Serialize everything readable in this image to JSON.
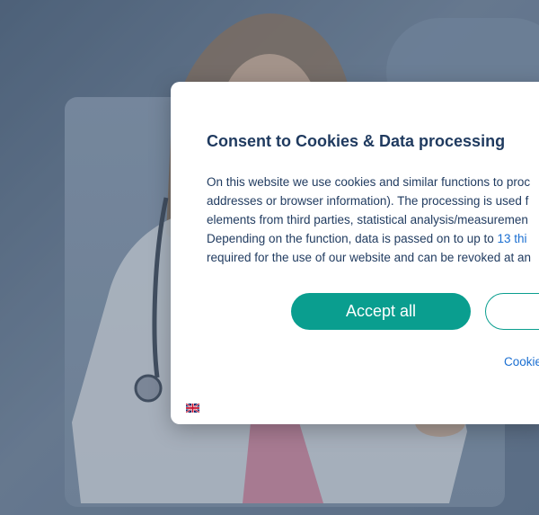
{
  "consent": {
    "title": "Consent to Cookies & Data processing",
    "body_line1": "On this website we use cookies and similar functions to proc",
    "body_line2": "addresses or browser information). The processing is used f",
    "body_line3": "elements from third parties, statistical analysis/measuremen",
    "body_line4_prefix": "Depending on the function, data is passed on to up to ",
    "body_line4_link": "13 thi",
    "body_line5": "required for the use of our website and can be revoked at an",
    "accept_label": "Accept all",
    "second_label": "",
    "cookie_link_label": "Cookie"
  },
  "language": {
    "flag_icon": "uk-flag-icon"
  },
  "colors": {
    "accent": "#0a9e8f",
    "title": "#1f3a5f",
    "link": "#1b6fd1"
  }
}
